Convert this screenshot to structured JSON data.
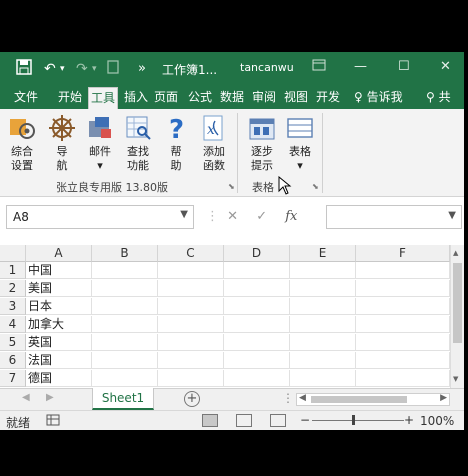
{
  "titlebar": {
    "save_icon": "save-icon",
    "undo": "↶",
    "redo": "↷",
    "more": "»",
    "doc_title": "工作簿1...",
    "user": "tancanwu",
    "ribbon_display_icon": "ribbon-display-icon",
    "minimize": "—",
    "maximize": "☐",
    "close": "✕"
  },
  "tabs": [
    "文件",
    "开始",
    "工具",
    "插入",
    "页面",
    "公式",
    "数据",
    "审阅",
    "视图",
    "开发"
  ],
  "active_tab": "工具",
  "tell_me": "告诉我",
  "share": "共",
  "ribbon": {
    "group1": {
      "label": "张立良专用版 13.80版",
      "buttons": [
        {
          "label1": "综合",
          "label2": "设置",
          "icon": "settings-icon"
        },
        {
          "label1": "导",
          "label2": "航",
          "icon": "navigation-icon"
        },
        {
          "label1": "邮件",
          "label2": "▾",
          "icon": "mail-icon"
        },
        {
          "label1": "查找",
          "label2": "功能",
          "icon": "find-icon"
        },
        {
          "label1": "帮",
          "label2": "助",
          "icon": "help-icon"
        },
        {
          "label1": "添加",
          "label2": "函数",
          "icon": "add-function-icon"
        }
      ]
    },
    "group2": {
      "label": "表格",
      "buttons": [
        {
          "label1": "逐步",
          "label2": "提示",
          "icon": "step-hint-icon"
        },
        {
          "label1": "表格",
          "label2": "▾",
          "icon": "table-icon"
        }
      ]
    }
  },
  "formula_bar": {
    "name_box": "A8",
    "cancel": "✕",
    "enter": "✓",
    "fx": "fx",
    "value": ""
  },
  "grid": {
    "columns": [
      "A",
      "B",
      "C",
      "D",
      "E",
      "F"
    ],
    "rows": [
      {
        "num": "1",
        "a": "中国"
      },
      {
        "num": "2",
        "a": "美国"
      },
      {
        "num": "3",
        "a": "日本"
      },
      {
        "num": "4",
        "a": "加拿大"
      },
      {
        "num": "5",
        "a": "英国"
      },
      {
        "num": "6",
        "a": "法国"
      },
      {
        "num": "7",
        "a": "德国"
      }
    ]
  },
  "sheets": [
    "Sheet1"
  ],
  "statusbar": {
    "ready": "就绪",
    "zoom": "100%",
    "zoom_minus": "−",
    "zoom_plus": "+"
  }
}
